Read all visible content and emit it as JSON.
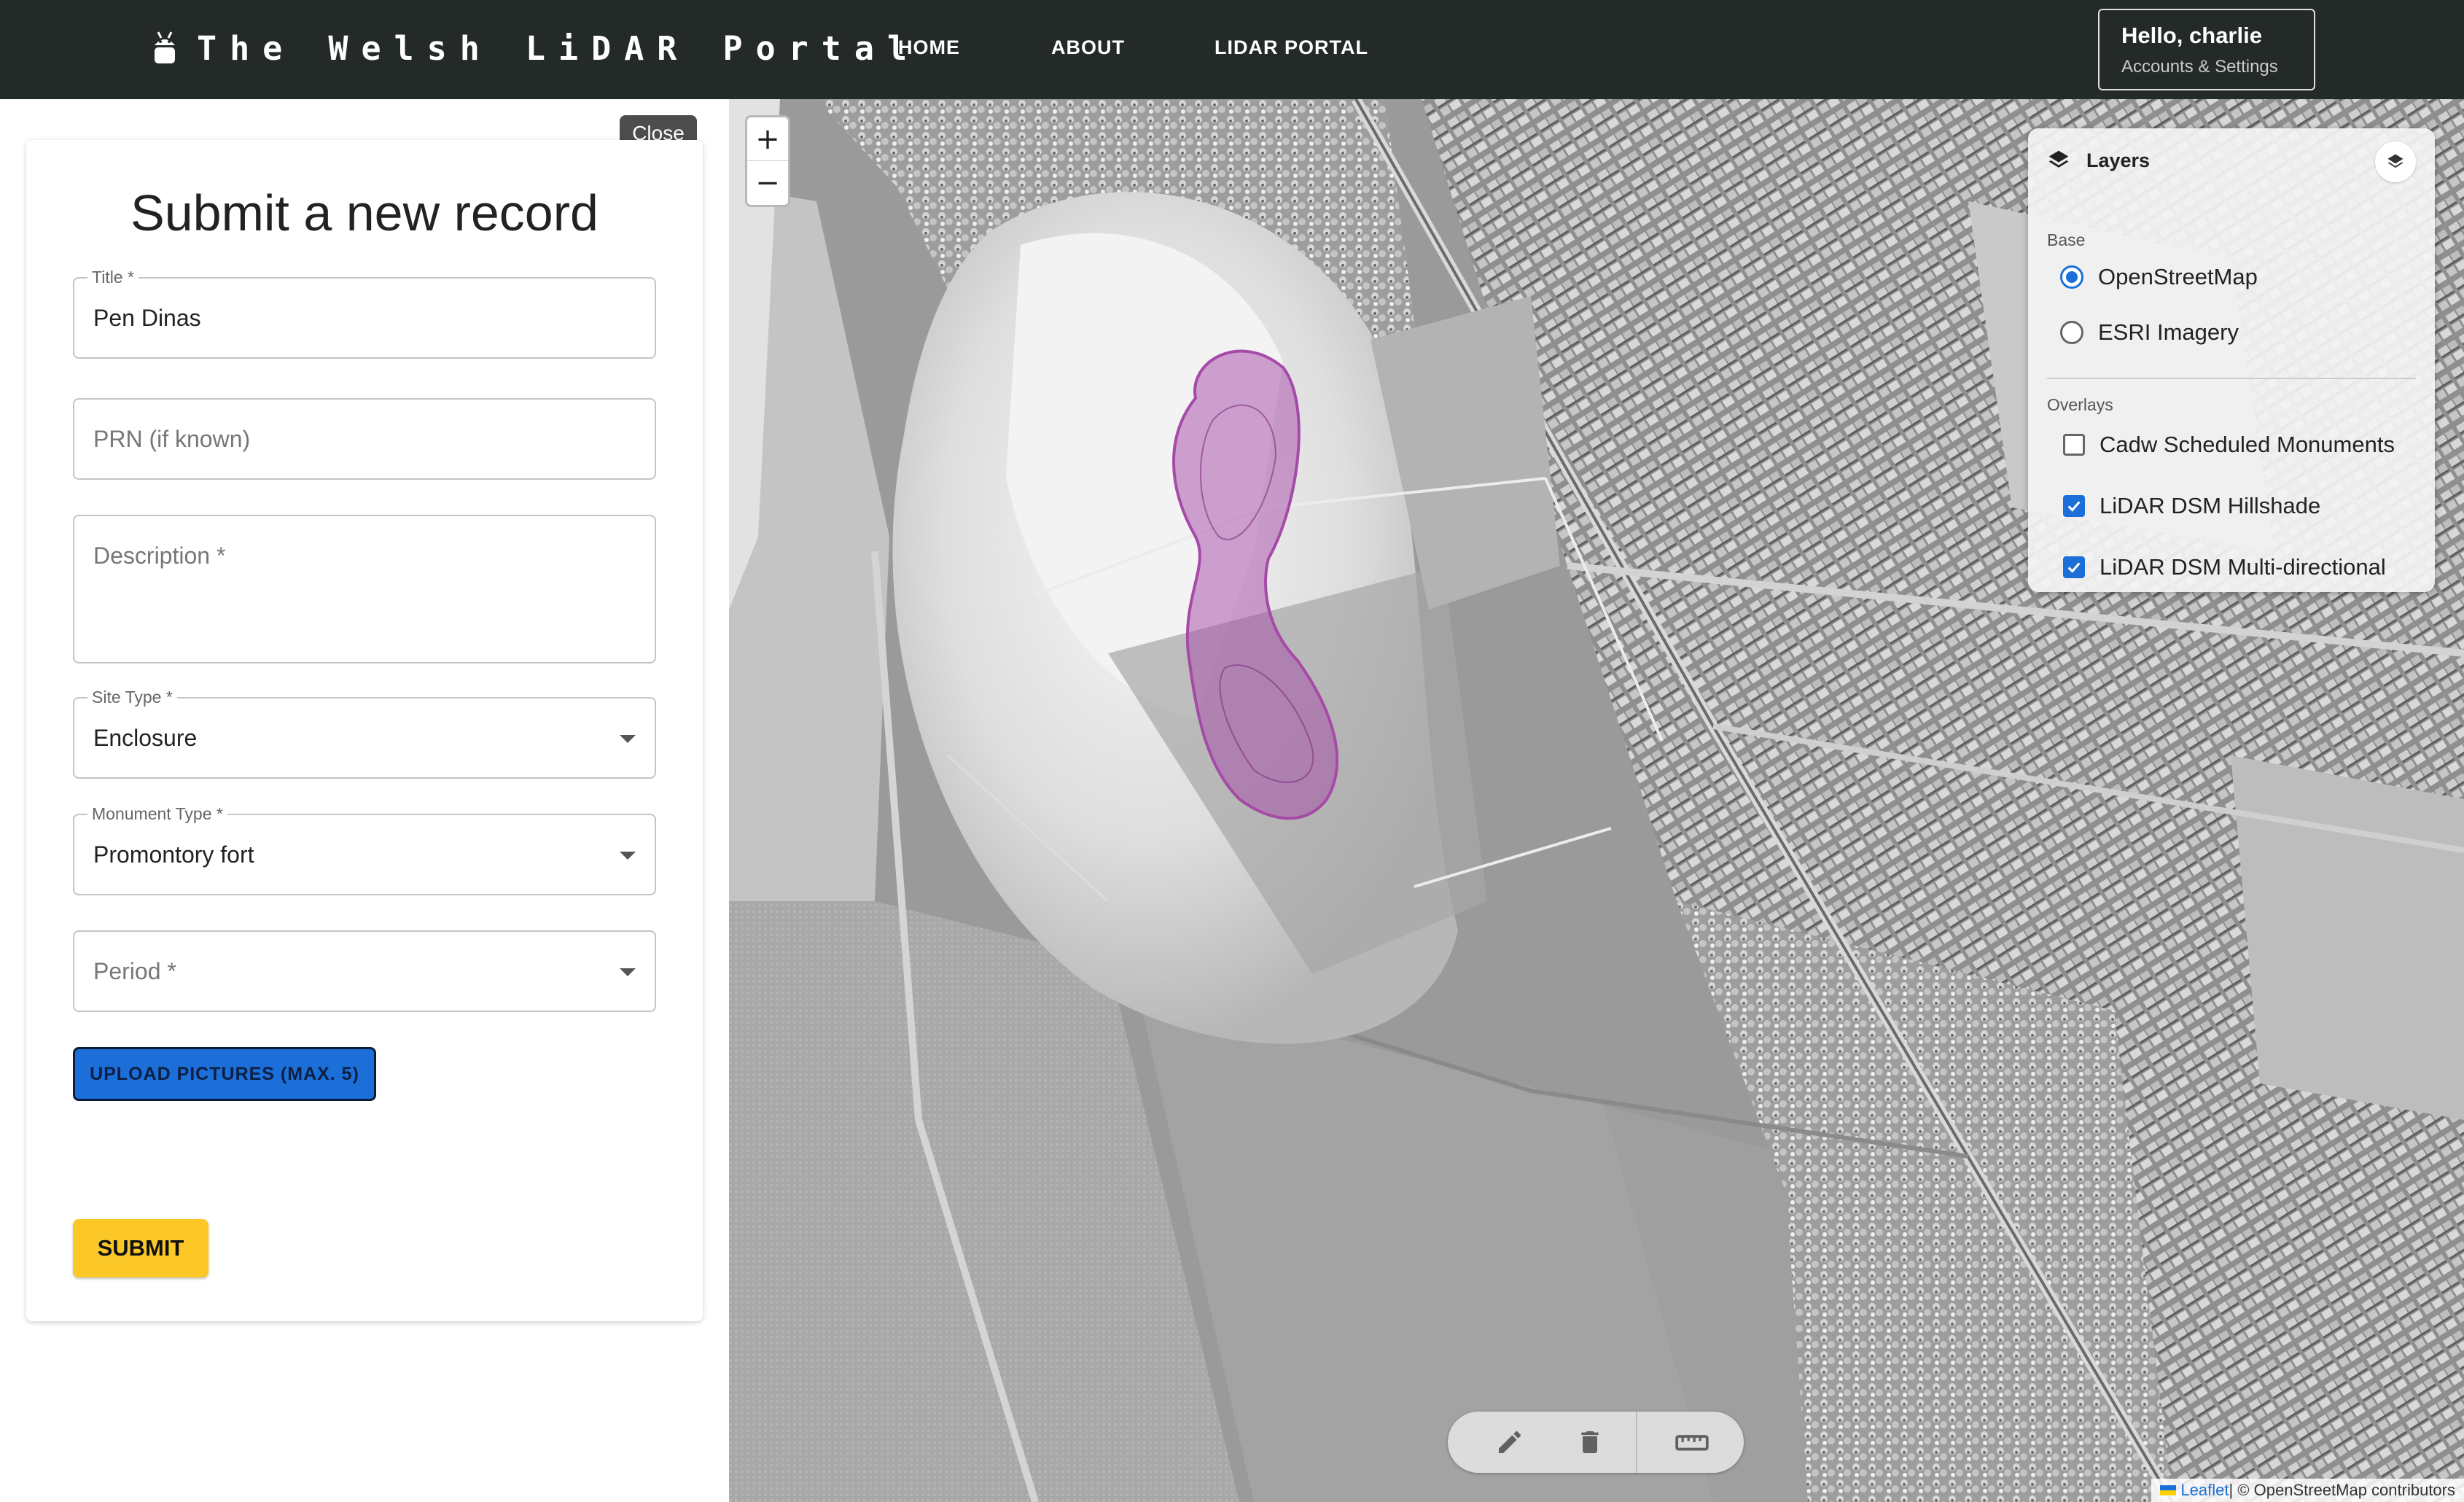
{
  "navbar": {
    "brand": "The Welsh LiDAR Portal",
    "links": {
      "home": "HOME",
      "about": "ABOUT",
      "portal": "LIDAR PORTAL"
    },
    "account": {
      "greeting": "Hello, charlie",
      "sub": "Accounts & Settings"
    }
  },
  "form": {
    "close_label": "Close",
    "heading": "Submit a new record",
    "title_field": {
      "label": "Title *",
      "value": "Pen Dinas"
    },
    "prn_field": {
      "placeholder": "PRN (if known)"
    },
    "description_field": {
      "placeholder": "Description *"
    },
    "site_type": {
      "label": "Site Type *",
      "value": "Enclosure"
    },
    "monument_type": {
      "label": "Monument Type *",
      "value": "Promontory fort"
    },
    "period": {
      "placeholder": "Period *"
    },
    "upload_label": "UPLOAD PICTURES (MAX. 5)",
    "submit_label": "SUBMIT"
  },
  "map": {
    "zoom_in": "+",
    "zoom_out": "−",
    "layers": {
      "title": "Layers",
      "base_label": "Base",
      "base_options": [
        {
          "label": "OpenStreetMap",
          "selected": true
        },
        {
          "label": "ESRI Imagery",
          "selected": false
        }
      ],
      "overlays_label": "Overlays",
      "overlay_options": [
        {
          "label": "Cadw Scheduled Monuments",
          "checked": false
        },
        {
          "label": "LiDAR DSM Hillshade",
          "checked": true
        },
        {
          "label": "LiDAR DSM Multi-directional",
          "checked": true
        }
      ]
    },
    "toolbar": {
      "icons": [
        "pencil-icon",
        "trash-icon",
        "ruler-icon"
      ]
    },
    "attribution": {
      "leaflet": "Leaflet",
      "rest": " | © OpenStreetMap contributors"
    },
    "colors": {
      "polygon": "#a64aa8",
      "accent": "#1c6fd8",
      "submit": "#fbc827",
      "navbar": "#232a27"
    }
  }
}
